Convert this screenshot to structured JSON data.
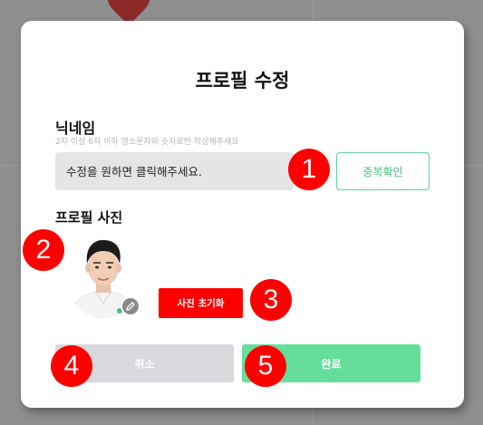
{
  "modal": {
    "title": "프로필 수정",
    "nickname": {
      "label": "닉네임",
      "hint": "2자 이상 6자 이하 영소문자와 숫자로만 작성해주세요",
      "placeholder": "수정을 원하면 클릭해주세요.",
      "dup_check_label": "중복확인"
    },
    "photo": {
      "label": "프로필 사진",
      "avatar_icon": "user-photo",
      "edit_icon": "pencil-icon",
      "reset_label": "사진 초기화"
    },
    "actions": {
      "cancel_label": "취소",
      "done_label": "완료"
    }
  },
  "callouts": [
    "1",
    "2",
    "3",
    "4",
    "5"
  ],
  "colors": {
    "accent_red": "#ff0000",
    "accent_green": "#66de9b",
    "green_border": "#5fd49a",
    "cancel_gray": "#d8d9dd"
  }
}
